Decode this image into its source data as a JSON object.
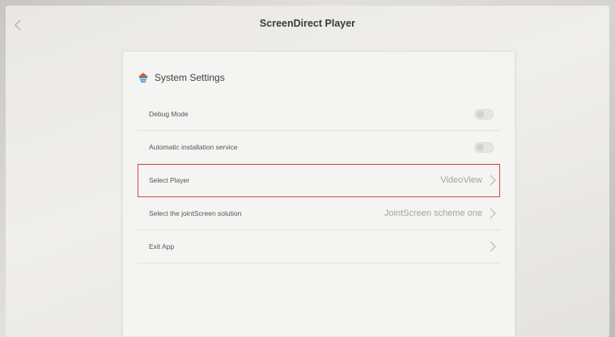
{
  "header": {
    "title": "ScreenDirect Player",
    "back_icon": "chevron-left-icon"
  },
  "panel": {
    "title": "System Settings",
    "icon": "settings-house-icon",
    "rows": [
      {
        "label": "Debug Mode",
        "type": "toggle",
        "on": false
      },
      {
        "label": "Automatic installation service",
        "type": "toggle",
        "on": false
      },
      {
        "label": "Select Player",
        "type": "select",
        "value": "VideoView",
        "highlighted": true
      },
      {
        "label": "Select the jointScreen solution",
        "type": "select",
        "value": "JointScreen scheme one"
      },
      {
        "label": "Exit App",
        "type": "link",
        "value": ""
      }
    ]
  },
  "colors": {
    "highlight": "#d9473f",
    "icon_accent": "#e05a2a",
    "icon_blue": "#3d8fd6"
  }
}
